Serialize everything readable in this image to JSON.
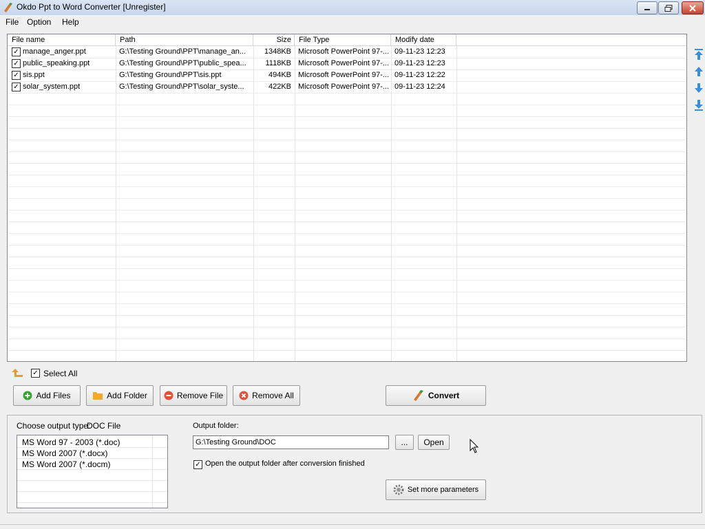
{
  "window": {
    "title": "Okdo Ppt to Word Converter [Unregister]"
  },
  "menu": {
    "items": [
      "File",
      "Option",
      "Help"
    ]
  },
  "table": {
    "columns": [
      "File name",
      "Path",
      "Size",
      "File Type",
      "Modify date"
    ],
    "rows": [
      {
        "checked": true,
        "name": "manage_anger.ppt",
        "path": "G:\\Testing Ground\\PPT\\manage_an...",
        "size": "1348KB",
        "type": "Microsoft PowerPoint 97-...",
        "date": "09-11-23 12:23"
      },
      {
        "checked": true,
        "name": "public_speaking.ppt",
        "path": "G:\\Testing Ground\\PPT\\public_spea...",
        "size": "1118KB",
        "type": "Microsoft PowerPoint 97-...",
        "date": "09-11-23 12:23"
      },
      {
        "checked": true,
        "name": "sis.ppt",
        "path": "G:\\Testing Ground\\PPT\\sis.ppt",
        "size": "494KB",
        "type": "Microsoft PowerPoint 97-...",
        "date": "09-11-23 12:22"
      },
      {
        "checked": true,
        "name": "solar_system.ppt",
        "path": "G:\\Testing Ground\\PPT\\solar_syste...",
        "size": "422KB",
        "type": "Microsoft PowerPoint 97-...",
        "date": "09-11-23 12:24"
      }
    ]
  },
  "select_all": {
    "label": "Select All",
    "checked": true
  },
  "buttons": {
    "add_files": "Add Files",
    "add_folder": "Add Folder",
    "remove_file": "Remove File",
    "remove_all": "Remove All",
    "convert": "Convert",
    "browse": "...",
    "open": "Open",
    "set_params": "Set more parameters"
  },
  "output_type": {
    "label": "Choose output type:",
    "value": "DOC File",
    "options": [
      "MS Word 97 - 2003 (*.doc)",
      "MS Word 2007 (*.docx)",
      "MS Word 2007 (*.docm)"
    ]
  },
  "output_folder": {
    "label": "Output folder:",
    "value": "G:\\Testing Ground\\DOC"
  },
  "open_after": {
    "label": "Open the output folder after conversion finished",
    "checked": true
  },
  "colors": {
    "add_icon": "#3aa335",
    "folder_icon": "#f0a830",
    "remove_icon": "#e0533a",
    "arrow_icon": "#3a8fdc"
  }
}
